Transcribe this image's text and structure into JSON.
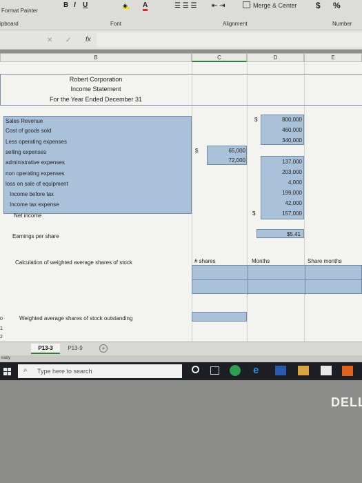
{
  "ribbon": {
    "format_painter": "Format Painter",
    "clipboard": "ipboard",
    "font_label": "Font",
    "alignment_label": "Alignment",
    "number_label": "Number",
    "bold": "B",
    "italic": "I",
    "underline": "U",
    "merge_center": "Merge & Center",
    "currency": "$",
    "percent": "%"
  },
  "formula_bar": {
    "fx": "fx",
    "cancel": "✕",
    "enter": "✓"
  },
  "columns": [
    "B",
    "C",
    "D",
    "E"
  ],
  "header": {
    "company": "Robert Corporation",
    "statement": "Income Statement",
    "period": "For the Year Ended December 31"
  },
  "rows": [
    {
      "label": "Sales Revenue",
      "c": "",
      "d_sym": "$",
      "d": "800,000"
    },
    {
      "label": "Cost of goods sold",
      "c": "",
      "d": "460,000"
    },
    {
      "label": "Less operating expenses",
      "c": "",
      "d": "340,000"
    },
    {
      "label": "selling expenses",
      "c_sym": "$",
      "c": "65,000",
      "d": ""
    },
    {
      "label": "administrative expenses",
      "c": "72,000",
      "d": "137,000"
    },
    {
      "label": "non operating expenses",
      "c": "",
      "d": "203,000"
    },
    {
      "label": "loss on sale of equipment",
      "c": "",
      "d": "4,000"
    },
    {
      "label": "Income before tax",
      "c": "",
      "d": "199,000"
    },
    {
      "label": "Income tax expense",
      "c": "",
      "d": "42,000"
    },
    {
      "label": "Net income",
      "c": "",
      "d_sym": "$",
      "d": "157,000"
    }
  ],
  "eps": {
    "label": "Earnings per share",
    "value": "$5.41"
  },
  "calc": {
    "label": "Calculation of weighted average shares of stock",
    "shares": "# shares",
    "months": "Months",
    "share_months": "Share months"
  },
  "weighted": {
    "label": "Weighted average shares of stock outstanding"
  },
  "row_numbers": [
    "0",
    "1",
    "2"
  ],
  "tabs": [
    "P13-3",
    "P13-9"
  ],
  "add_sheet": "+",
  "status": "eady",
  "taskbar": {
    "search_placeholder": "Type here to search"
  },
  "brand": "DELL",
  "colors": {
    "accent": "#a9c2d9",
    "taskbar": "#1d1f24"
  }
}
